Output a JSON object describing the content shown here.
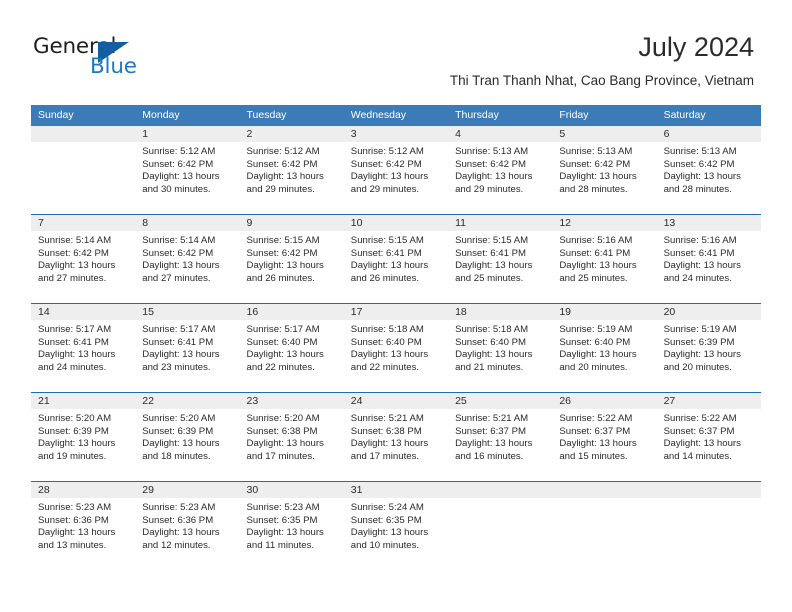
{
  "brand": {
    "name_part1": "General",
    "name_part2": "Blue"
  },
  "header": {
    "title": "July 2024",
    "subtitle": "Thi Tran Thanh Nhat, Cao Bang Province, Vietnam"
  },
  "colors": {
    "header_blue": "#3b7cb8",
    "row_divider_blue": "#1f6cb0",
    "date_band_gray": "#eeeeee",
    "logo_blue": "#1c7ac0",
    "text": "#2b2b2b"
  },
  "calendar": {
    "weekdays": [
      "Sunday",
      "Monday",
      "Tuesday",
      "Wednesday",
      "Thursday",
      "Friday",
      "Saturday"
    ],
    "weeks": [
      [
        {
          "date": "",
          "lines": []
        },
        {
          "date": "1",
          "lines": [
            "Sunrise: 5:12 AM",
            "Sunset: 6:42 PM",
            "Daylight: 13 hours",
            "and 30 minutes."
          ]
        },
        {
          "date": "2",
          "lines": [
            "Sunrise: 5:12 AM",
            "Sunset: 6:42 PM",
            "Daylight: 13 hours",
            "and 29 minutes."
          ]
        },
        {
          "date": "3",
          "lines": [
            "Sunrise: 5:12 AM",
            "Sunset: 6:42 PM",
            "Daylight: 13 hours",
            "and 29 minutes."
          ]
        },
        {
          "date": "4",
          "lines": [
            "Sunrise: 5:13 AM",
            "Sunset: 6:42 PM",
            "Daylight: 13 hours",
            "and 29 minutes."
          ]
        },
        {
          "date": "5",
          "lines": [
            "Sunrise: 5:13 AM",
            "Sunset: 6:42 PM",
            "Daylight: 13 hours",
            "and 28 minutes."
          ]
        },
        {
          "date": "6",
          "lines": [
            "Sunrise: 5:13 AM",
            "Sunset: 6:42 PM",
            "Daylight: 13 hours",
            "and 28 minutes."
          ]
        }
      ],
      [
        {
          "date": "7",
          "lines": [
            "Sunrise: 5:14 AM",
            "Sunset: 6:42 PM",
            "Daylight: 13 hours",
            "and 27 minutes."
          ]
        },
        {
          "date": "8",
          "lines": [
            "Sunrise: 5:14 AM",
            "Sunset: 6:42 PM",
            "Daylight: 13 hours",
            "and 27 minutes."
          ]
        },
        {
          "date": "9",
          "lines": [
            "Sunrise: 5:15 AM",
            "Sunset: 6:42 PM",
            "Daylight: 13 hours",
            "and 26 minutes."
          ]
        },
        {
          "date": "10",
          "lines": [
            "Sunrise: 5:15 AM",
            "Sunset: 6:41 PM",
            "Daylight: 13 hours",
            "and 26 minutes."
          ]
        },
        {
          "date": "11",
          "lines": [
            "Sunrise: 5:15 AM",
            "Sunset: 6:41 PM",
            "Daylight: 13 hours",
            "and 25 minutes."
          ]
        },
        {
          "date": "12",
          "lines": [
            "Sunrise: 5:16 AM",
            "Sunset: 6:41 PM",
            "Daylight: 13 hours",
            "and 25 minutes."
          ]
        },
        {
          "date": "13",
          "lines": [
            "Sunrise: 5:16 AM",
            "Sunset: 6:41 PM",
            "Daylight: 13 hours",
            "and 24 minutes."
          ]
        }
      ],
      [
        {
          "date": "14",
          "lines": [
            "Sunrise: 5:17 AM",
            "Sunset: 6:41 PM",
            "Daylight: 13 hours",
            "and 24 minutes."
          ]
        },
        {
          "date": "15",
          "lines": [
            "Sunrise: 5:17 AM",
            "Sunset: 6:41 PM",
            "Daylight: 13 hours",
            "and 23 minutes."
          ]
        },
        {
          "date": "16",
          "lines": [
            "Sunrise: 5:17 AM",
            "Sunset: 6:40 PM",
            "Daylight: 13 hours",
            "and 22 minutes."
          ]
        },
        {
          "date": "17",
          "lines": [
            "Sunrise: 5:18 AM",
            "Sunset: 6:40 PM",
            "Daylight: 13 hours",
            "and 22 minutes."
          ]
        },
        {
          "date": "18",
          "lines": [
            "Sunrise: 5:18 AM",
            "Sunset: 6:40 PM",
            "Daylight: 13 hours",
            "and 21 minutes."
          ]
        },
        {
          "date": "19",
          "lines": [
            "Sunrise: 5:19 AM",
            "Sunset: 6:40 PM",
            "Daylight: 13 hours",
            "and 20 minutes."
          ]
        },
        {
          "date": "20",
          "lines": [
            "Sunrise: 5:19 AM",
            "Sunset: 6:39 PM",
            "Daylight: 13 hours",
            "and 20 minutes."
          ]
        }
      ],
      [
        {
          "date": "21",
          "lines": [
            "Sunrise: 5:20 AM",
            "Sunset: 6:39 PM",
            "Daylight: 13 hours",
            "and 19 minutes."
          ]
        },
        {
          "date": "22",
          "lines": [
            "Sunrise: 5:20 AM",
            "Sunset: 6:39 PM",
            "Daylight: 13 hours",
            "and 18 minutes."
          ]
        },
        {
          "date": "23",
          "lines": [
            "Sunrise: 5:20 AM",
            "Sunset: 6:38 PM",
            "Daylight: 13 hours",
            "and 17 minutes."
          ]
        },
        {
          "date": "24",
          "lines": [
            "Sunrise: 5:21 AM",
            "Sunset: 6:38 PM",
            "Daylight: 13 hours",
            "and 17 minutes."
          ]
        },
        {
          "date": "25",
          "lines": [
            "Sunrise: 5:21 AM",
            "Sunset: 6:37 PM",
            "Daylight: 13 hours",
            "and 16 minutes."
          ]
        },
        {
          "date": "26",
          "lines": [
            "Sunrise: 5:22 AM",
            "Sunset: 6:37 PM",
            "Daylight: 13 hours",
            "and 15 minutes."
          ]
        },
        {
          "date": "27",
          "lines": [
            "Sunrise: 5:22 AM",
            "Sunset: 6:37 PM",
            "Daylight: 13 hours",
            "and 14 minutes."
          ]
        }
      ],
      [
        {
          "date": "28",
          "lines": [
            "Sunrise: 5:23 AM",
            "Sunset: 6:36 PM",
            "Daylight: 13 hours",
            "and 13 minutes."
          ]
        },
        {
          "date": "29",
          "lines": [
            "Sunrise: 5:23 AM",
            "Sunset: 6:36 PM",
            "Daylight: 13 hours",
            "and 12 minutes."
          ]
        },
        {
          "date": "30",
          "lines": [
            "Sunrise: 5:23 AM",
            "Sunset: 6:35 PM",
            "Daylight: 13 hours",
            "and 11 minutes."
          ]
        },
        {
          "date": "31",
          "lines": [
            "Sunrise: 5:24 AM",
            "Sunset: 6:35 PM",
            "Daylight: 13 hours",
            "and 10 minutes."
          ]
        },
        {
          "date": "",
          "lines": []
        },
        {
          "date": "",
          "lines": []
        },
        {
          "date": "",
          "lines": []
        }
      ]
    ]
  }
}
